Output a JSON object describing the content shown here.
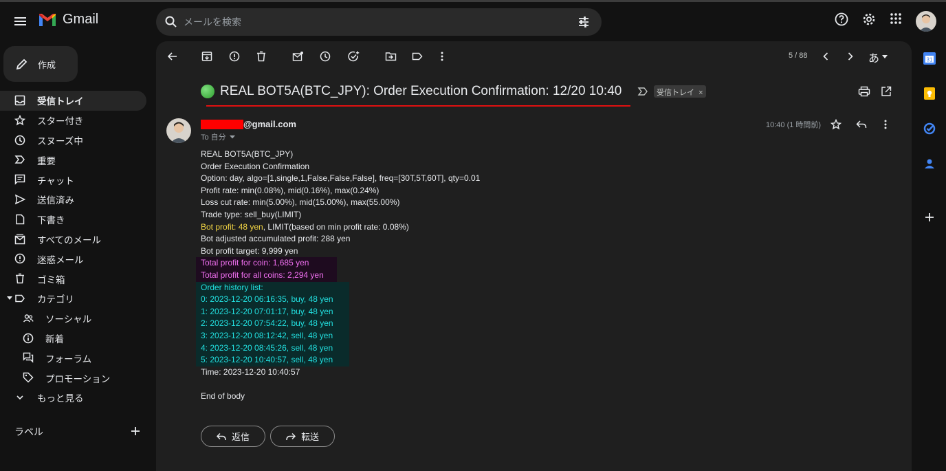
{
  "app": {
    "name": "Gmail"
  },
  "search": {
    "placeholder": "メールを検索"
  },
  "compose": {
    "label": "作成"
  },
  "sidebar": {
    "items": [
      {
        "label": "受信トレイ",
        "icon": "inbox-icon",
        "active": true
      },
      {
        "label": "スター付き",
        "icon": "star-icon"
      },
      {
        "label": "スヌーズ中",
        "icon": "clock-icon"
      },
      {
        "label": "重要",
        "icon": "important-icon"
      },
      {
        "label": "チャット",
        "icon": "chat-icon"
      },
      {
        "label": "送信済み",
        "icon": "send-icon"
      },
      {
        "label": "下書き",
        "icon": "draft-icon"
      },
      {
        "label": "すべてのメール",
        "icon": "all-mail-icon"
      },
      {
        "label": "迷惑メール",
        "icon": "spam-icon"
      },
      {
        "label": "ゴミ箱",
        "icon": "trash-icon"
      },
      {
        "label": "カテゴリ",
        "icon": "label-icon"
      },
      {
        "label": "ソーシャル",
        "icon": "people-icon"
      },
      {
        "label": "新着",
        "icon": "info-icon"
      },
      {
        "label": "フォーラム",
        "icon": "forum-icon"
      },
      {
        "label": "プロモーション",
        "icon": "tag-icon"
      },
      {
        "label": "もっと見る",
        "icon": "chevron-down-icon"
      }
    ],
    "labels_heading": "ラベル"
  },
  "toolbar": {
    "pager": "5 / 88",
    "input_tool": "あ"
  },
  "email": {
    "subject": "REAL BOT5A(BTC_JPY): Order Execution Confirmation: 12/20 10:40",
    "label_chip": "受信トレイ",
    "label_chip_close": "×",
    "sender_domain": "@gmail.com",
    "to": "To 自分",
    "time": "10:40 (1 時間前)",
    "body": {
      "l1": "REAL BOT5A(BTC_JPY)",
      "l2": "Order Execution Confirmation",
      "l3": "Option: day, algo=[1,single,1,False,False,False], freq=[30T,5T,60T], qty=0.01",
      "l4": "Profit rate: min(0.08%), mid(0.16%), max(0.24%)",
      "l5": "Loss cut rate: min(5.00%), mid(15.00%), max(55.00%)",
      "l6": "Trade type: sell_buy(LIMIT)",
      "l7a": "Bot profit: 48 yen",
      "l7b": ", LIMIT(based on min profit rate: 0.08%)",
      "l8": "Bot adjusted accumulated profit: 288 yen",
      "l9": "Bot profit target: 9,999 yen",
      "l10": "Total profit for coin: 1,685 yen",
      "l11": "Total profit for all coins: 2,294 yen",
      "history_title": "Order history list:",
      "history": [
        "0: 2023-12-20 06:16:35, buy, 48 yen",
        "1: 2023-12-20 07:01:17, buy, 48 yen",
        "2: 2023-12-20 07:54:22, buy, 48 yen",
        "3: 2023-12-20 08:12:42, sell, 48 yen",
        "4: 2023-12-20 08:45:26, sell, 48 yen",
        "5: 2023-12-20 10:40:57, sell, 48 yen"
      ],
      "time_line": "Time: 2023-12-20 10:40:57",
      "end": "End of body"
    },
    "reply_label": "返信",
    "forward_label": "転送"
  },
  "colors": {
    "redaction": "#ff0000",
    "underline": "#e01010",
    "yellow_text": "#f2d544",
    "pink_text": "#f06ff0",
    "cyan_text": "#22e0e0"
  }
}
